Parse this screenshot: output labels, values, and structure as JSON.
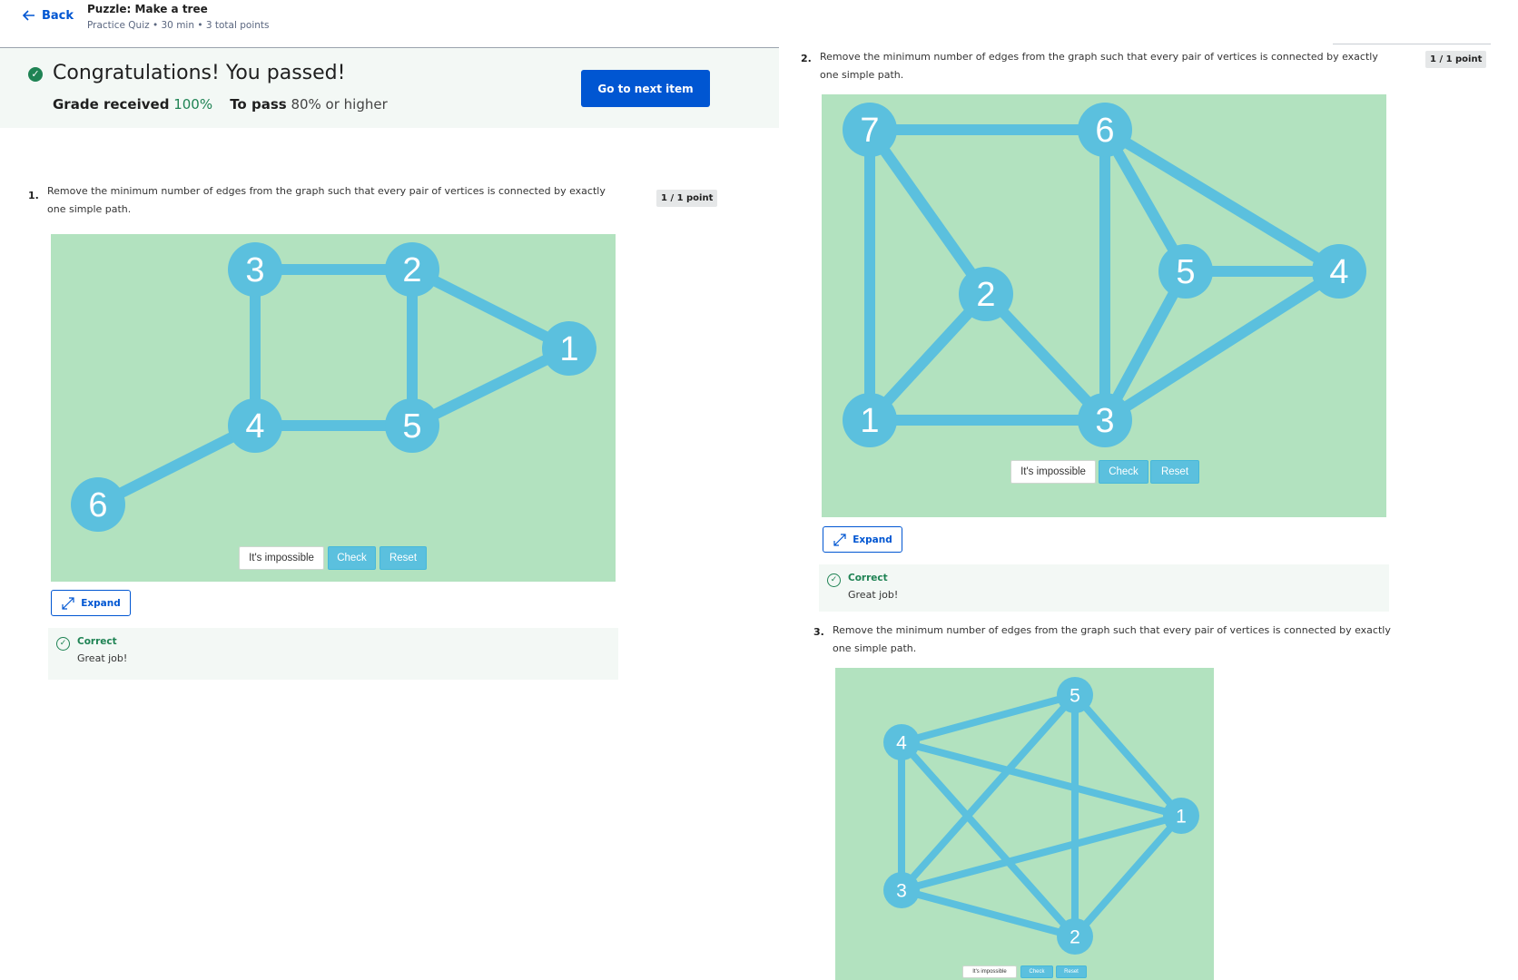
{
  "header": {
    "back_label": "Back",
    "title": "Puzzle: Make a tree",
    "meta": "Practice Quiz • 30 min • 3 total points"
  },
  "banner": {
    "title": "Congratulations! You passed!",
    "grade_label": "Grade received",
    "grade_value": "100%",
    "pass_label": "To pass",
    "pass_value": "80% or higher",
    "next_button": "Go to next item"
  },
  "common": {
    "impossible_button": "It's impossible",
    "check_button": "Check",
    "reset_button": "Reset",
    "expand_button": "Expand",
    "feedback_title": "Correct",
    "feedback_text": "Great job!"
  },
  "questions": [
    {
      "number": "1.",
      "text": "Remove the minimum number of edges from the graph such that every pair of vertices is connected by exactly one simple path.",
      "points": "1 / 1 point",
      "nodes": [
        "1",
        "2",
        "3",
        "4",
        "5",
        "6"
      ],
      "edges": [
        [
          "3",
          "2"
        ],
        [
          "2",
          "1"
        ],
        [
          "3",
          "4"
        ],
        [
          "2",
          "5"
        ],
        [
          "4",
          "5"
        ],
        [
          "5",
          "1"
        ],
        [
          "4",
          "6"
        ]
      ]
    },
    {
      "number": "2.",
      "text": "Remove the minimum number of edges from the graph such that every pair of vertices is connected by exactly one simple path.",
      "points": "1 / 1 point",
      "nodes": [
        "1",
        "2",
        "3",
        "4",
        "5",
        "6",
        "7"
      ],
      "edges": [
        [
          "7",
          "6"
        ],
        [
          "7",
          "1"
        ],
        [
          "7",
          "2"
        ],
        [
          "2",
          "1"
        ],
        [
          "2",
          "3"
        ],
        [
          "1",
          "3"
        ],
        [
          "6",
          "3"
        ],
        [
          "6",
          "5"
        ],
        [
          "6",
          "4"
        ],
        [
          "5",
          "4"
        ],
        [
          "5",
          "3"
        ],
        [
          "4",
          "3"
        ]
      ]
    },
    {
      "number": "3.",
      "text": "Remove the minimum number of edges from the graph such that every pair of vertices is connected by exactly one simple path.",
      "nodes": [
        "1",
        "2",
        "3",
        "4",
        "5"
      ],
      "edges": [
        [
          "1",
          "2"
        ],
        [
          "1",
          "3"
        ],
        [
          "1",
          "4"
        ],
        [
          "1",
          "5"
        ],
        [
          "2",
          "3"
        ],
        [
          "2",
          "4"
        ],
        [
          "2",
          "5"
        ],
        [
          "3",
          "4"
        ],
        [
          "3",
          "5"
        ],
        [
          "4",
          "5"
        ]
      ]
    }
  ],
  "colors": {
    "brand_blue": "#0056d2",
    "success_green": "#1f8354",
    "graph_background": "#b2e2bf",
    "graph_edge": "#5bc0de"
  },
  "icons": {
    "back": "arrow-left-icon",
    "pass": "check-circle-icon",
    "expand": "expand-arrows-icon",
    "feedback": "check-circle-outline-icon"
  }
}
